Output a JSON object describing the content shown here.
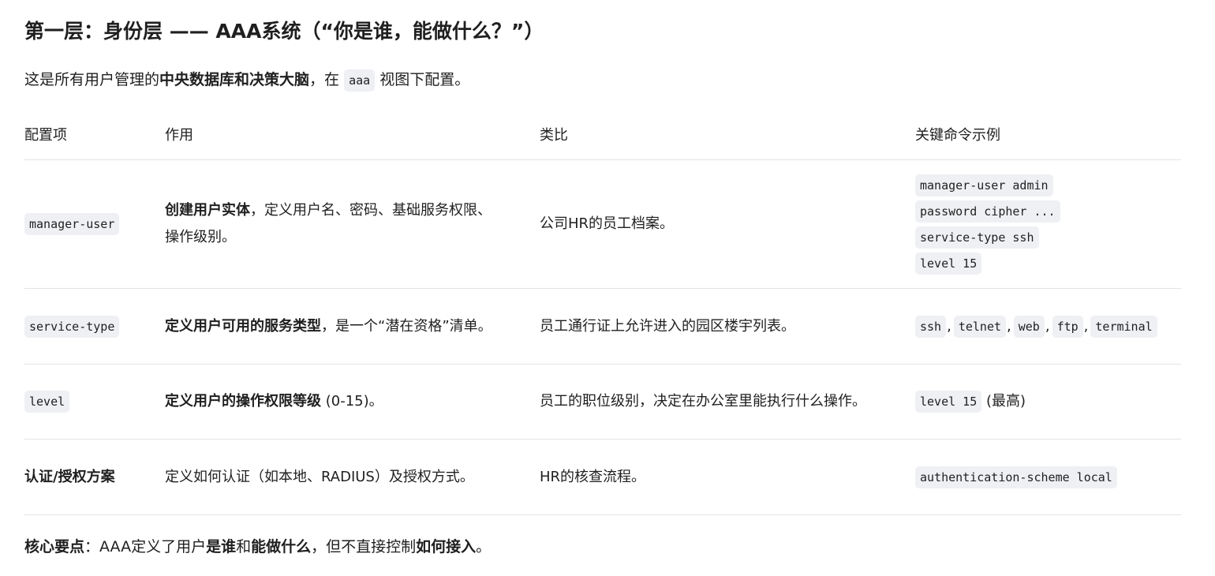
{
  "title": "第一层：身份层 —— AAA系统（“你是谁，能做什么？”）",
  "intro": {
    "pre": "这是所有用户管理的",
    "bold": "中央数据库和决策大脑",
    "mid": "，在 ",
    "code": "aaa",
    "post": " 视图下配置。"
  },
  "table": {
    "headers": [
      "配置项",
      "作用",
      "类比",
      "关键命令示例"
    ],
    "rows": [
      {
        "item": "manager-user",
        "role_bold": "创建用户实体",
        "role_rest": "，定义用户名、密码、基础服务权限、操作级别。",
        "analogy": "公司HR的员工档案。",
        "commands": [
          "manager-user admin",
          "password cipher ...",
          "service-type ssh",
          "level 15"
        ]
      },
      {
        "item": "service-type",
        "role_bold": "定义用户可用的服务类型",
        "role_rest": "，是一个“潜在资格”清单。",
        "analogy": "员工通行证上允许进入的园区楼宇列表。",
        "commands": [
          "ssh",
          "telnet",
          "web",
          "ftp",
          "terminal"
        ],
        "separator": ","
      },
      {
        "item": "level",
        "role_bold": "定义用户的操作权限等级",
        "role_rest": " (0-15)。",
        "analogy": "员工的职位级别，决定在办公室里能执行什么操作。",
        "command": "level 15",
        "command_note": " (最高)"
      },
      {
        "item": "认证/授权方案",
        "role": "定义如何认证（如本地、RADIUS）及授权方式。",
        "analogy": "HR的核查流程。",
        "command": "authentication-scheme local"
      }
    ]
  },
  "summary": {
    "label": "核心要点",
    "p1": "：AAA定义了用户",
    "b1": "是谁",
    "p2": "和",
    "b2": "能做什么",
    "p3": "，但不直接控制",
    "b3": "如何接入",
    "p4": "。"
  }
}
